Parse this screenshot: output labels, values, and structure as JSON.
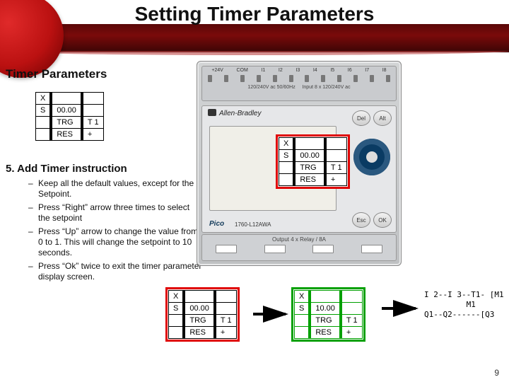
{
  "title": "Setting Timer Parameters",
  "subhead": "Timer Parameters",
  "step_heading": "5. Add Timer instruction",
  "bullets": [
    "Keep all the default values, except for the Setpoint.",
    "Press “Right” arrow three times to select the setpoint",
    "Press “Up” arrow to change the value from 0 to 1. This will change the setpoint to 10 seconds.",
    "Press “Ok” twice to exit the timer parameter display screen."
  ],
  "param_box": {
    "r1c1": "X",
    "r1c2": "",
    "r2c1": "S",
    "r2c2": "00.00",
    "r3c1": "",
    "r3c2": "TRG",
    "r3c3": "T 1",
    "r4c1": "",
    "r4c2": "RES",
    "r4c3": "+"
  },
  "param_box_result": {
    "r2c2": "10.00"
  },
  "device": {
    "brand": "Allen-Bradley",
    "keys": {
      "del": "Del",
      "alt": "Alt",
      "esc": "Esc",
      "ok": "OK"
    },
    "pico": "Pico",
    "model": "1760-L12AWA",
    "top_labels": [
      "+24V",
      "COM",
      "I1",
      "I2",
      "I3",
      "I4",
      "I5",
      "I6",
      "I7",
      "I8"
    ],
    "top_legend_left": "120/240V ac 50/60Hz",
    "top_legend_right": "Input 8 x 120/240V ac",
    "bottom_label": "Output 4 x Relay / 8A"
  },
  "ladder": {
    "line1": "I 2--I 3--T1- [M1",
    "line2": "M1",
    "line3": "Q1--Q2------[Q3"
  },
  "page_number": "9"
}
